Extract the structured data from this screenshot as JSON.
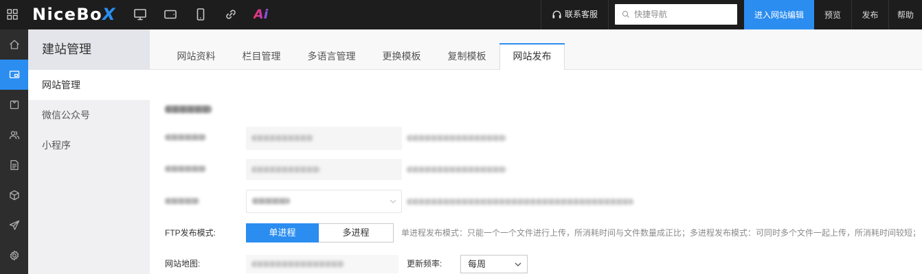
{
  "topbar": {
    "logo_main": "NiceBo",
    "logo_accent": "X",
    "ai_icon_text": "Ai",
    "device_icons": [
      "desktop-icon",
      "tablet-icon",
      "mobile-icon",
      "link-icon",
      "ai-icon"
    ],
    "support_label": "联系客服",
    "search_placeholder": "快捷导航",
    "edit_button_label": "进入网站编辑",
    "preview_label": "预览",
    "publish_label": "发布",
    "help_label": "帮助"
  },
  "icon_sidebar": {
    "icons": [
      "home-icon",
      "website-icon",
      "shop-icon",
      "users-icon",
      "document-icon",
      "cube-icon",
      "send-icon",
      "settings-icon"
    ],
    "active_icon": "website-icon"
  },
  "sub_sidebar": {
    "title": "建站管理",
    "items": [
      {
        "label": "网站管理",
        "active": true
      },
      {
        "label": "微信公众号",
        "active": false
      },
      {
        "label": "小程序",
        "active": false
      }
    ]
  },
  "tabs": [
    {
      "label": "网站资料",
      "active": false
    },
    {
      "label": "栏目管理",
      "active": false
    },
    {
      "label": "多语言管理",
      "active": false
    },
    {
      "label": "更换模板",
      "active": false
    },
    {
      "label": "复制模板",
      "active": false
    },
    {
      "label": "网站发布",
      "active": true
    }
  ],
  "publish_form": {
    "ftp_mode": {
      "label": "FTP发布模式:",
      "options": [
        "单进程",
        "多进程"
      ],
      "selected": "单进程",
      "hint": "单进程发布模式：只能一个一个文件进行上传，所消耗时间与文件数量成正比；多进程发布模式：可同时多个文件一起上传，所消耗时间较短；"
    },
    "sitemap": {
      "label": "网站地图:",
      "frequency_label": "更新频率:",
      "frequency_value": "每周"
    }
  },
  "colors": {
    "accent": "#2b8df0",
    "topbar_bg": "#1d1d1d",
    "icon_sidebar_bg": "#2d2d2d",
    "sub_sidebar_bg": "#f0f0f2",
    "sub_sidebar_header_bg": "#e4e5ea"
  }
}
